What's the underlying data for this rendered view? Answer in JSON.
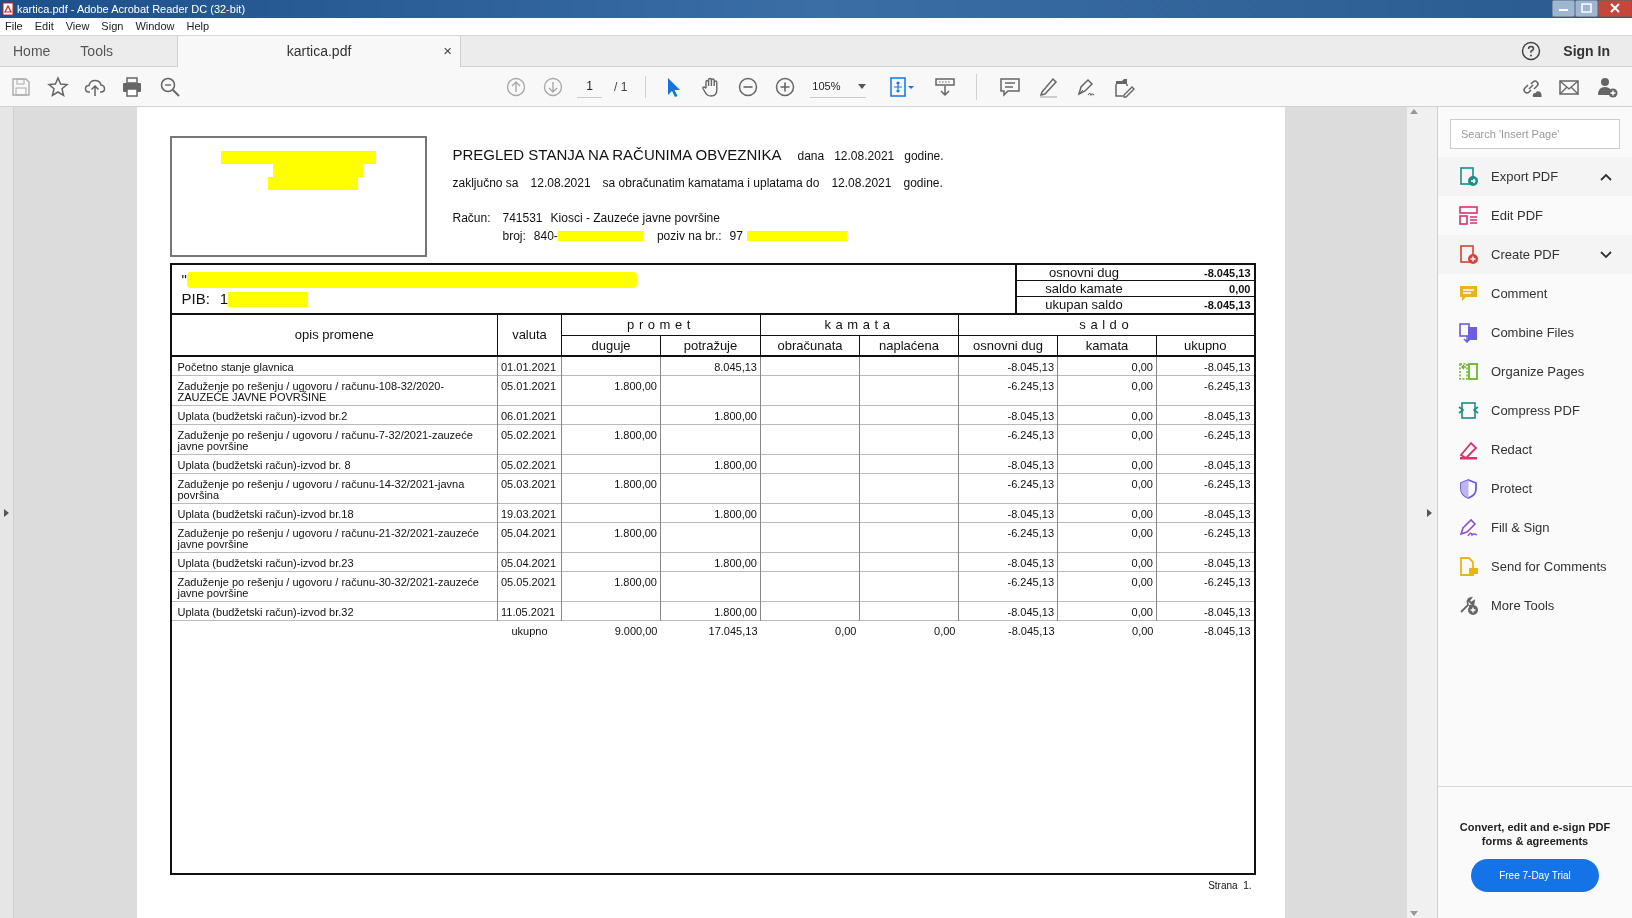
{
  "window": {
    "title": "kartica.pdf - Adobe Acrobat Reader DC (32-bit)"
  },
  "menu": [
    "File",
    "Edit",
    "View",
    "Sign",
    "Window",
    "Help"
  ],
  "tabs": [
    {
      "label": "Home",
      "selected": false
    },
    {
      "label": "Tools",
      "selected": false
    },
    {
      "label": "kartica.pdf",
      "selected": true,
      "close": "×"
    }
  ],
  "sign_in": "Sign In",
  "toolbar": {
    "page_current": "1",
    "page_total": "/ 1",
    "zoom": "105%"
  },
  "document": {
    "title": "PREGLED STANJA NA RAČUNIMA OBVEZNIKA",
    "dana_label": "dana",
    "date": "12.08.2021",
    "godine": "godine.",
    "line2": [
      "zaključno sa",
      "12.08.2021",
      "sa obračunatim kamatama i uplatama do",
      "12.08.2021",
      "godine."
    ],
    "racun_label": "Račun:",
    "racun_number": "741531",
    "racun_name": "Kiosci - Zauzeće javne površine",
    "broj_label": "broj:",
    "broj_value": "840-",
    "poziv_label": "poziv na br.:",
    "poziv_value": "97",
    "taxpayer_name": "\"",
    "pib_label": "PIB:",
    "pib_value": "1",
    "summary": [
      {
        "label": "osnovni dug",
        "value": "-8.045,13"
      },
      {
        "label": "saldo kamate",
        "value": "0,00"
      },
      {
        "label": "ukupan saldo",
        "value": "-8.045,13"
      }
    ],
    "column_groups": [
      {
        "label": "promet"
      },
      {
        "label": "kamata"
      },
      {
        "label": "saldo"
      }
    ],
    "columns": [
      "opis promene",
      "valuta",
      "duguje",
      "potražuje",
      "obračunata",
      "naplaćena",
      "osnovni dug",
      "kamata",
      "ukupno"
    ],
    "rows": [
      [
        "Početno stanje glavnica",
        "01.01.2021",
        "",
        "8.045,13",
        "",
        "",
        "-8.045,13",
        "0,00",
        "-8.045,13"
      ],
      [
        "Zaduženje po rešenju / ugovoru / računu-108-32/2020-ZAUZEĆE JAVNE POVRŠINE",
        "05.01.2021",
        "1.800,00",
        "",
        "",
        "",
        "-6.245,13",
        "0,00",
        "-6.245,13"
      ],
      [
        "Uplata (budžetski račun)-izvod br.2",
        "06.01.2021",
        "",
        "1.800,00",
        "",
        "",
        "-8.045,13",
        "0,00",
        "-8.045,13"
      ],
      [
        "Zaduženje po rešenju / ugovoru / računu-7-32/2021-zauzeće javne površine",
        "05.02.2021",
        "1.800,00",
        "",
        "",
        "",
        "-6.245,13",
        "0,00",
        "-6.245,13"
      ],
      [
        "Uplata (budžetski račun)-izvod br. 8",
        "05.02.2021",
        "",
        "1.800,00",
        "",
        "",
        "-8.045,13",
        "0,00",
        "-8.045,13"
      ],
      [
        "Zaduženje po rešenju / ugovoru / računu-14-32/2021-javna površina",
        "05.03.2021",
        "1.800,00",
        "",
        "",
        "",
        "-6.245,13",
        "0,00",
        "-6.245,13"
      ],
      [
        "Uplata (budžetski račun)-izvod br.18",
        "19.03.2021",
        "",
        "1.800,00",
        "",
        "",
        "-8.045,13",
        "0,00",
        "-8.045,13"
      ],
      [
        "Zaduženje po rešenju / ugovoru / računu-21-32/2021-zauzeće javne površine",
        "05.04.2021",
        "1.800,00",
        "",
        "",
        "",
        "-6.245,13",
        "0,00",
        "-6.245,13"
      ],
      [
        "Uplata (budžetski račun)-izvod br.23",
        "05.04.2021",
        "",
        "1.800,00",
        "",
        "",
        "-8.045,13",
        "0,00",
        "-8.045,13"
      ],
      [
        "Zaduženje po rešenju / ugovoru / računu-30-32/2021-zauzeće javne površine",
        "05.05.2021",
        "1.800,00",
        "",
        "",
        "",
        "-6.245,13",
        "0,00",
        "-6.245,13"
      ],
      [
        "Uplata (budžetski račun)-izvod br.32",
        "11.05.2021",
        "",
        "1.800,00",
        "",
        "",
        "-8.045,13",
        "0,00",
        "-8.045,13"
      ]
    ],
    "total": [
      "ukupno",
      "9.000,00",
      "17.045,13",
      "0,00",
      "0,00",
      "-8.045,13",
      "0,00",
      "-8.045,13"
    ],
    "footer": "Strana  1."
  },
  "right_panel": {
    "search": {
      "placeholder": "Search 'Insert Page'"
    },
    "tools": [
      {
        "label": "Export PDF",
        "kind": "group",
        "expanded": true
      },
      {
        "label": "Edit PDF",
        "kind": "tool"
      },
      {
        "label": "Create PDF",
        "kind": "group",
        "expanded": false
      },
      {
        "label": "Comment",
        "kind": "tool"
      },
      {
        "label": "Combine Files",
        "kind": "tool"
      },
      {
        "label": "Organize Pages",
        "kind": "tool"
      },
      {
        "label": "Compress PDF",
        "kind": "tool"
      },
      {
        "label": "Redact",
        "kind": "tool"
      },
      {
        "label": "Protect",
        "kind": "tool"
      },
      {
        "label": "Fill & Sign",
        "kind": "tool"
      },
      {
        "label": "Send for Comments",
        "kind": "tool"
      },
      {
        "label": "More Tools",
        "kind": "tool"
      }
    ],
    "promo": "Convert, edit and e-sign PDF forms & agreements",
    "trial_button": "Free 7-Day Trial"
  }
}
